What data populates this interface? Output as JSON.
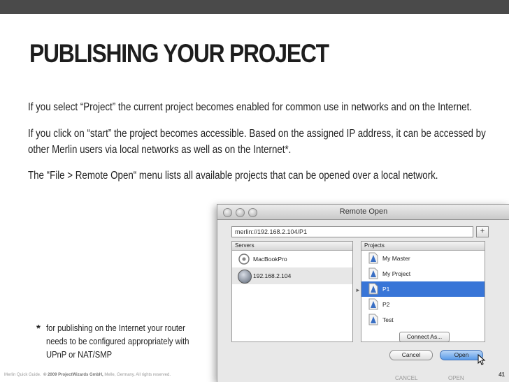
{
  "slide": {
    "title": "PUBLISHING YOUR PROJECT",
    "paragraph1": "If you select “Project” the current project becomes enabled for common use in networks and on the Internet.",
    "paragraph2_line1": "If you click on “start” the project becomes accessible. Based on the assigned IP address, it can be accessed by",
    "paragraph2_line2": "other Merlin users via local networks as well as on the Internet*.",
    "paragraph3": "The “File > Remote Open“ menu lists all available projects that can be opened over a local network."
  },
  "window": {
    "title": "Remote Open",
    "url_value": "merlin://192.168.2.104/P1",
    "add_label": "+",
    "servers_header": "Servers",
    "servers": [
      "MacBookPro",
      "192.168.2.104"
    ],
    "projects_header": "Projects",
    "projects": [
      "My Master",
      "My Project",
      "P1",
      "P2",
      "Test"
    ],
    "selected_project": "P1",
    "connect_label": "Connect As...",
    "cancel_label": "Cancel",
    "open_label": "Open",
    "ghost_cancel": "CANCEL",
    "ghost_open": "OPEN"
  },
  "footnote": {
    "star": "*",
    "line1": "for publishing on the Internet your router",
    "line2": "needs to be configured appropriately with",
    "line3": "UPnP or NAT/SMP"
  },
  "footer": {
    "brand": "Merlin Quick Guide.",
    "copyright_prefix": "© 2009 ProjectWizards GmbH,",
    "copyright_suffix": " Melle, Germany. All rights reserved.",
    "page_number": "41"
  },
  "colors": {
    "selection": "#3875d7",
    "topbar": "#4a4a4a"
  },
  "icons": [
    "server-icon",
    "globe-icon",
    "project-file-icon",
    "mouse-cursor-icon"
  ]
}
